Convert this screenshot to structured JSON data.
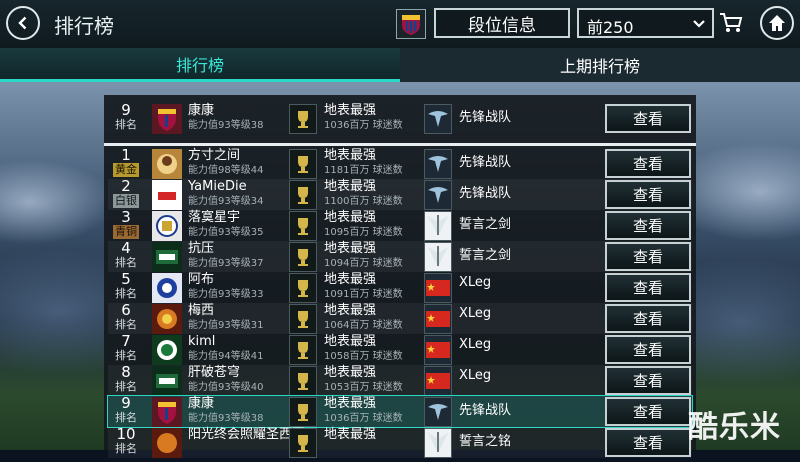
{
  "header": {
    "title": "排行榜",
    "rank_info_label": "段位信息",
    "filter_value": "前250"
  },
  "tabs": [
    {
      "label": "排行榜",
      "active": true
    },
    {
      "label": "上期排行榜",
      "active": false
    }
  ],
  "rank_label": "排名",
  "medals": {
    "gold": "黄金",
    "silver": "白银",
    "bronze": "青铜"
  },
  "view_label": "查看",
  "my_row": {
    "rank": "9",
    "name": "康康",
    "sub": "能力值93等级38",
    "league": "地表最强",
    "league_sub": "1036百万 球迷数",
    "team": "先锋战队"
  },
  "rows": [
    {
      "rank": "1",
      "medal": "黄金",
      "name": "方寸之间",
      "sub": "能力值98等级44",
      "league": "地表最强",
      "league_sub": "1181百万 球迷数",
      "team": "先锋战队"
    },
    {
      "rank": "2",
      "medal": "白银",
      "name": "YaMieDie",
      "sub": "能力值93等级34",
      "league": "地表最强",
      "league_sub": "1100百万 球迷数",
      "team": "先锋战队"
    },
    {
      "rank": "3",
      "medal": "青铜",
      "name": "落寞星宇",
      "sub": "能力值93等级35",
      "league": "地表最强",
      "league_sub": "1095百万 球迷数",
      "team": "誓言之剑"
    },
    {
      "rank": "4",
      "medal": "排名",
      "name": "抗压",
      "sub": "能力值93等级37",
      "league": "地表最强",
      "league_sub": "1094百万 球迷数",
      "team": "誓言之剑"
    },
    {
      "rank": "5",
      "medal": "排名",
      "name": "阿布",
      "sub": "能力值93等级33",
      "league": "地表最强",
      "league_sub": "1091百万 球迷数",
      "team": "XLeg"
    },
    {
      "rank": "6",
      "medal": "排名",
      "name": "梅西",
      "sub": "能力值93等级31",
      "league": "地表最强",
      "league_sub": "1064百万 球迷数",
      "team": "XLeg"
    },
    {
      "rank": "7",
      "medal": "排名",
      "name": "kiml",
      "sub": "能力值94等级41",
      "league": "地表最强",
      "league_sub": "1058百万 球迷数",
      "team": "XLeg"
    },
    {
      "rank": "8",
      "medal": "排名",
      "name": "肝破苍穹",
      "sub": "能力值93等级40",
      "league": "地表最强",
      "league_sub": "1053百万 球迷数",
      "team": "XLeg"
    },
    {
      "rank": "9",
      "medal": "排名",
      "name": "康康",
      "sub": "能力值93等级38",
      "league": "地表最强",
      "league_sub": "1036百万 球迷数",
      "team": "先锋战队"
    },
    {
      "rank": "10",
      "medal": "排名",
      "name": "阳光终会照耀圣西罗",
      "sub": "",
      "league": "地表最强",
      "league_sub": "",
      "team": "誓言之铭"
    }
  ],
  "watermark": "酷乐米",
  "colors": {
    "accent": "#28d8c8",
    "gold": "#b89a2c",
    "silver": "#8c979a",
    "bronze": "#9a6a35"
  }
}
